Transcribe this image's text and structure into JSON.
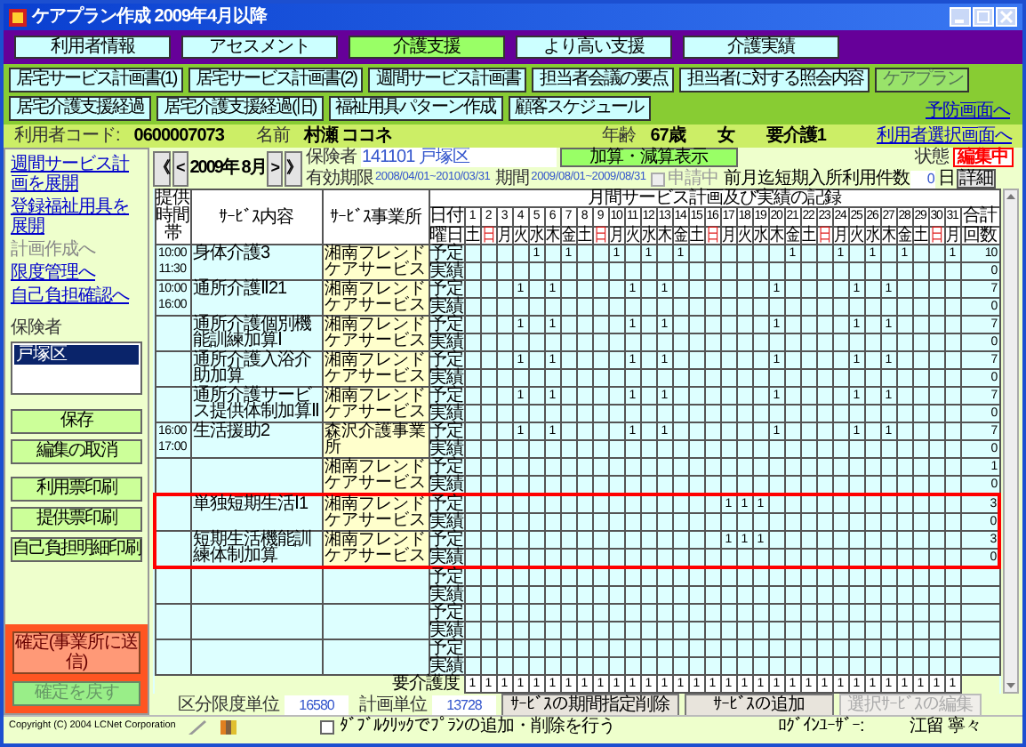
{
  "window": {
    "title": "ケアプラン作成 2009年4月以降"
  },
  "main_tabs": [
    {
      "label": "利用者情報",
      "selected": false
    },
    {
      "label": "アセスメント",
      "selected": false
    },
    {
      "label": "介護支援",
      "selected": true
    },
    {
      "label": "より高い支援",
      "selected": false
    },
    {
      "label": "介護実績",
      "selected": false
    }
  ],
  "sub_buttons": [
    [
      {
        "label": "居宅サービス計画書(1)",
        "selected": false
      },
      {
        "label": "居宅サービス計画書(2)",
        "selected": false
      },
      {
        "label": "週間サービス計画書",
        "selected": false
      },
      {
        "label": "担当者会議の要点",
        "selected": false
      },
      {
        "label": "担当者に対する照会内容",
        "selected": false
      },
      {
        "label": "ケアプラン",
        "selected": true
      }
    ],
    [
      {
        "label": "居宅介護支援経過",
        "selected": false
      },
      {
        "label": "居宅介護支援経過(旧)",
        "selected": false
      },
      {
        "label": "福祉用具パターン作成",
        "selected": false
      },
      {
        "label": "顧客スケジュール",
        "selected": false
      }
    ]
  ],
  "prevention_link": "予防画面へ",
  "user": {
    "code_label": "利用者コード:",
    "code": "0600007073",
    "name_label": "名前",
    "name": "村瀬 ココネ",
    "age_label": "年齢",
    "age": "67歳",
    "sex": "女",
    "care_level": "要介護1"
  },
  "user_select_link": "利用者選択画面へ",
  "sidebar": {
    "links": [
      {
        "label": "週間サービス計画を展開",
        "disabled": false
      },
      {
        "label": "登録福祉用具を展開",
        "disabled": false
      },
      {
        "label": "計画作成へ",
        "disabled": true
      },
      {
        "label": "限度管理へ",
        "disabled": false
      },
      {
        "label": "自己負担確認へ",
        "disabled": false
      }
    ],
    "insurer_label": "保険者",
    "insurer_list": [
      {
        "label": "戸塚区",
        "selected": true
      }
    ],
    "buttons": [
      "保存",
      "編集の取消",
      "利用票印刷",
      "提供票印刷",
      "自己負担明細印刷"
    ],
    "confirm_button": {
      "label": "確定(事業所に送信)",
      "disabled": false
    },
    "undo_button": {
      "label": "確定を戻す",
      "disabled": true
    }
  },
  "month_nav": {
    "first": "《",
    "prev": "<",
    "month": "2009年 8月",
    "next": ">",
    "last": "》"
  },
  "insurer": {
    "label": "保険者",
    "value": "141101 戸塚区"
  },
  "adjust_button": "加算・減算表示",
  "status": {
    "label": "状態",
    "value": "編集中"
  },
  "validity": {
    "label": "有効期限",
    "value": "2008/04/01~2010/03/31"
  },
  "period": {
    "label": "期間",
    "value": "2009/08/01~2009/08/31"
  },
  "applying": {
    "label": "申請中",
    "checked": false,
    "disabled": true
  },
  "short_stay": {
    "label": "前月迄短期入所利用件数",
    "value": "0",
    "unit": "日"
  },
  "detail_button": "詳細",
  "table": {
    "headers": {
      "time": "提供時間帯",
      "content": "ｻｰﾋﾞｽ内容",
      "provider": "ｻｰﾋﾞｽ事業所",
      "record_title": "月間サービス計画及び実績の記録",
      "date_label": "日付",
      "weekday_label": "曜日",
      "total_top": "合計",
      "total_bottom": "回数"
    },
    "days": [
      {
        "date": "1",
        "weekday": "土",
        "sunday": false
      },
      {
        "date": "2",
        "weekday": "日",
        "sunday": true
      },
      {
        "date": "3",
        "weekday": "月",
        "sunday": false
      },
      {
        "date": "4",
        "weekday": "火",
        "sunday": false
      },
      {
        "date": "5",
        "weekday": "水",
        "sunday": false
      },
      {
        "date": "6",
        "weekday": "木",
        "sunday": false
      },
      {
        "date": "7",
        "weekday": "金",
        "sunday": false
      },
      {
        "date": "8",
        "weekday": "土",
        "sunday": false
      },
      {
        "date": "9",
        "weekday": "日",
        "sunday": true
      },
      {
        "date": "10",
        "weekday": "月",
        "sunday": false
      },
      {
        "date": "11",
        "weekday": "火",
        "sunday": false
      },
      {
        "date": "12",
        "weekday": "水",
        "sunday": false
      },
      {
        "date": "13",
        "weekday": "木",
        "sunday": false
      },
      {
        "date": "14",
        "weekday": "金",
        "sunday": false
      },
      {
        "date": "15",
        "weekday": "土",
        "sunday": false
      },
      {
        "date": "16",
        "weekday": "日",
        "sunday": true
      },
      {
        "date": "17",
        "weekday": "月",
        "sunday": false
      },
      {
        "date": "18",
        "weekday": "火",
        "sunday": false
      },
      {
        "date": "19",
        "weekday": "水",
        "sunday": false
      },
      {
        "date": "20",
        "weekday": "木",
        "sunday": false
      },
      {
        "date": "21",
        "weekday": "金",
        "sunday": false
      },
      {
        "date": "22",
        "weekday": "土",
        "sunday": false
      },
      {
        "date": "23",
        "weekday": "日",
        "sunday": true
      },
      {
        "date": "24",
        "weekday": "月",
        "sunday": false
      },
      {
        "date": "25",
        "weekday": "火",
        "sunday": false
      },
      {
        "date": "26",
        "weekday": "水",
        "sunday": false
      },
      {
        "date": "27",
        "weekday": "木",
        "sunday": false
      },
      {
        "date": "28",
        "weekday": "金",
        "sunday": false
      },
      {
        "date": "29",
        "weekday": "土",
        "sunday": false
      },
      {
        "date": "30",
        "weekday": "日",
        "sunday": true
      },
      {
        "date": "31",
        "weekday": "月",
        "sunday": false
      }
    ],
    "services": [
      {
        "time_start": "10:00",
        "time_end": "11:30",
        "content": "身体介護3",
        "provider": "湘南フレンドケアサービス",
        "plan_label": "予定",
        "actual_label": "実績",
        "plan": {
          "d5": "1",
          "d7": "1",
          "d10": "1",
          "d12": "1",
          "d14": "1",
          "d21": "1",
          "d24": "1",
          "d26": "1",
          "d28": "1",
          "d31": "1"
        },
        "plan_total": "10",
        "actual_total": "0",
        "highlighted": false
      },
      {
        "time_start": "10:00",
        "time_end": "16:00",
        "content": "通所介護Ⅱ21",
        "provider": "湘南フレンドケアサービス",
        "plan_label": "予定",
        "actual_label": "実績",
        "plan": {
          "d4": "1",
          "d6": "1",
          "d11": "1",
          "d13": "1",
          "d20": "1",
          "d25": "1",
          "d27": "1"
        },
        "plan_total": "7",
        "actual_total": "0",
        "highlighted": false
      },
      {
        "content": "通所介護個別機能訓練加算Ⅰ",
        "provider": "湘南フレンドケアサービス",
        "plan_label": "予定",
        "actual_label": "実績",
        "plan": {
          "d4": "1",
          "d6": "1",
          "d11": "1",
          "d13": "1",
          "d20": "1",
          "d25": "1",
          "d27": "1"
        },
        "plan_total": "7",
        "actual_total": "0",
        "highlighted": false
      },
      {
        "content": "通所介護入浴介助加算",
        "provider": "湘南フレンドケアサービス",
        "plan_label": "予定",
        "actual_label": "実績",
        "plan": {
          "d4": "1",
          "d6": "1",
          "d11": "1",
          "d13": "1",
          "d20": "1",
          "d25": "1",
          "d27": "1"
        },
        "plan_total": "7",
        "actual_total": "0",
        "highlighted": false
      },
      {
        "content": "通所介護サービス提供体制加算Ⅱ",
        "provider": "湘南フレンドケアサービス",
        "plan_label": "予定",
        "actual_label": "実績",
        "plan": {
          "d4": "1",
          "d6": "1",
          "d11": "1",
          "d13": "1",
          "d20": "1",
          "d25": "1",
          "d27": "1"
        },
        "plan_total": "7",
        "actual_total": "0",
        "highlighted": false
      },
      {
        "time_start": "16:00",
        "time_end": "17:00",
        "content": "生活援助2",
        "provider": "森沢介護事業所",
        "plan_label": "予定",
        "actual_label": "実績",
        "plan": {
          "d4": "1",
          "d6": "1",
          "d11": "1",
          "d13": "1",
          "d20": "1",
          "d25": "1",
          "d27": "1"
        },
        "plan_total": "7",
        "actual_total": "0",
        "highlighted": false
      },
      {
        "provider": "湘南フレンドケアサービス",
        "plan_label": "予定",
        "actual_label": "実績",
        "plan_total": "1",
        "actual_total": "0",
        "highlighted": false
      },
      {
        "content": "単独短期生活Ⅰ1",
        "provider": "湘南フレンドケアサービス",
        "plan_label": "予定",
        "actual_label": "実績",
        "plan": {
          "d17": "1",
          "d18": "1",
          "d19": "1"
        },
        "plan_total": "3",
        "actual_total": "0",
        "highlighted": true
      },
      {
        "content": "短期生活機能訓練体制加算",
        "provider": "湘南フレンドケアサービス",
        "plan_label": "予定",
        "actual_label": "実績",
        "plan": {
          "d17": "1",
          "d18": "1",
          "d19": "1"
        },
        "plan_total": "3",
        "actual_total": "0",
        "highlighted": true
      },
      {
        "plan_label": "予定",
        "actual_label": "実績",
        "highlighted": false
      },
      {
        "plan_label": "予定",
        "actual_label": "実績",
        "highlighted": false
      },
      {
        "plan_label": "予定",
        "actual_label": "実績",
        "highlighted": false
      }
    ],
    "care_level_row": {
      "label": "要介護度",
      "values": [
        "1",
        "1",
        "1",
        "1",
        "1",
        "1",
        "1",
        "1",
        "1",
        "1",
        "1",
        "1",
        "1",
        "1",
        "1",
        "1",
        "1",
        "1",
        "1",
        "1",
        "1",
        "1",
        "1",
        "1",
        "1",
        "1",
        "1",
        "1",
        "1",
        "1",
        "1"
      ]
    }
  },
  "bottom": {
    "limit_label": "区分限度単位",
    "limit": "16580",
    "plan_units_label": "計画単位",
    "plan_units": "13728",
    "buttons": [
      {
        "label": "ｻｰﾋﾞｽの期間指定削除",
        "disabled": false
      },
      {
        "label": "ｻｰﾋﾞｽの追加",
        "disabled": false
      },
      {
        "label": "選択ｻｰﾋﾞｽの編集",
        "disabled": true
      }
    ]
  },
  "footer": {
    "copyright": "Copyright (C) 2004 LCNet Corporation",
    "dblclick": {
      "label": "ﾀﾞﾌﾞﾙｸﾘｯｸでﾌﾟﾗﾝの追加・削除を行う",
      "checked": false
    },
    "login_label": "ﾛｸﾞｲﾝﾕｰｻﾞｰ:",
    "login_user": "江留 寧々"
  }
}
